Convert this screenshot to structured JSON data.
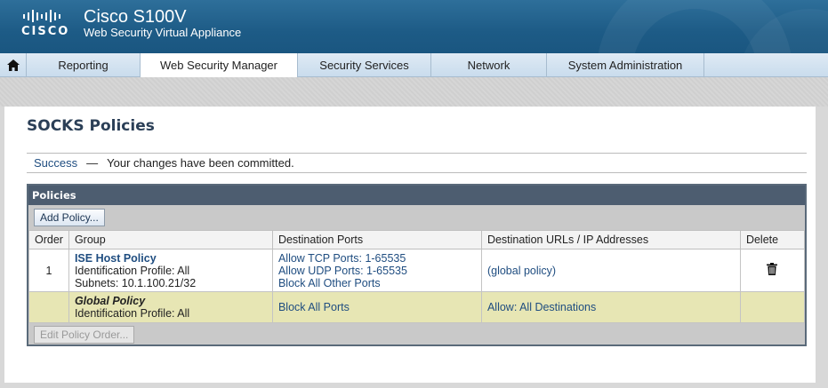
{
  "header": {
    "logo_text": "CISCO",
    "product_name": "Cisco S100V",
    "product_sub": "Web Security Virtual Appliance"
  },
  "nav": {
    "home_icon": "home-icon",
    "tabs": [
      {
        "label": "Reporting",
        "active": false
      },
      {
        "label": "Web Security Manager",
        "active": true
      },
      {
        "label": "Security Services",
        "active": false
      },
      {
        "label": "Network",
        "active": false
      },
      {
        "label": "System Administration",
        "active": false
      }
    ]
  },
  "page": {
    "title": "SOCKS Policies",
    "message": {
      "status": "Success",
      "separator": "—",
      "text": "Your changes have been committed."
    }
  },
  "policies": {
    "panel_title": "Policies",
    "add_button": "Add Policy...",
    "edit_order_button": "Edit Policy Order...",
    "columns": [
      "Order",
      "Group",
      "Destination Ports",
      "Destination URLs / IP Addresses",
      "Delete"
    ],
    "rows": [
      {
        "order": "1",
        "name": "ISE Host Policy",
        "identification": "Identification Profile: All",
        "subnets": "Subnets: 10.1.100.21/32",
        "ports": [
          "Allow TCP Ports: 1-65535",
          "Allow UDP Ports: 1-65535",
          "Block All Other Ports"
        ],
        "urls": "(global policy)",
        "delete_icon": "trash-icon"
      },
      {
        "order": "",
        "name": "Global Policy",
        "identification": "Identification Profile: All",
        "ports": [
          "Block All Ports"
        ],
        "urls": "Allow: All Destinations"
      }
    ]
  },
  "colors": {
    "header_blue": "#1d5b86",
    "panel_head": "#4d5d70",
    "global_row": "#e7e6b4",
    "link": "#1f4d80"
  }
}
